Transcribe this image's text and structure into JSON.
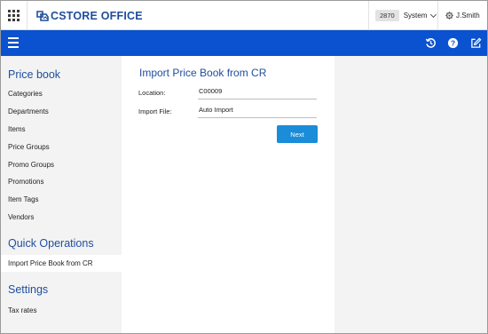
{
  "header": {
    "logo_text": "CSTORE OFFICE",
    "store_number": "2870",
    "store_name": "System",
    "user_name": "J.Smith"
  },
  "toolbar": {
    "icons": [
      "menu-icon",
      "history-icon",
      "help-icon",
      "edit-icon"
    ]
  },
  "sidebar": {
    "sections": [
      {
        "title": "Price book",
        "items": [
          "Categories",
          "Departments",
          "Items",
          "Price Groups",
          "Promo Groups",
          "Promotions",
          "Item Tags",
          "Vendors"
        ]
      },
      {
        "title": "Quick Operations",
        "items": [
          "Import Price Book from CR"
        ]
      },
      {
        "title": "Settings",
        "items": [
          "Tax rates"
        ]
      }
    ],
    "active_item": "Import Price Book from CR"
  },
  "main": {
    "title": "Import Price Book from CR",
    "fields": [
      {
        "label": "Location:",
        "value": "C00009"
      },
      {
        "label": "Import File:",
        "value": "Auto Import"
      }
    ],
    "next_label": "Next"
  },
  "colors": {
    "brand_blue": "#1f4e9c",
    "toolbar_blue": "#0a52cf",
    "button_blue": "#1a8cd8",
    "sidebar_bg": "#f3f3f3"
  }
}
